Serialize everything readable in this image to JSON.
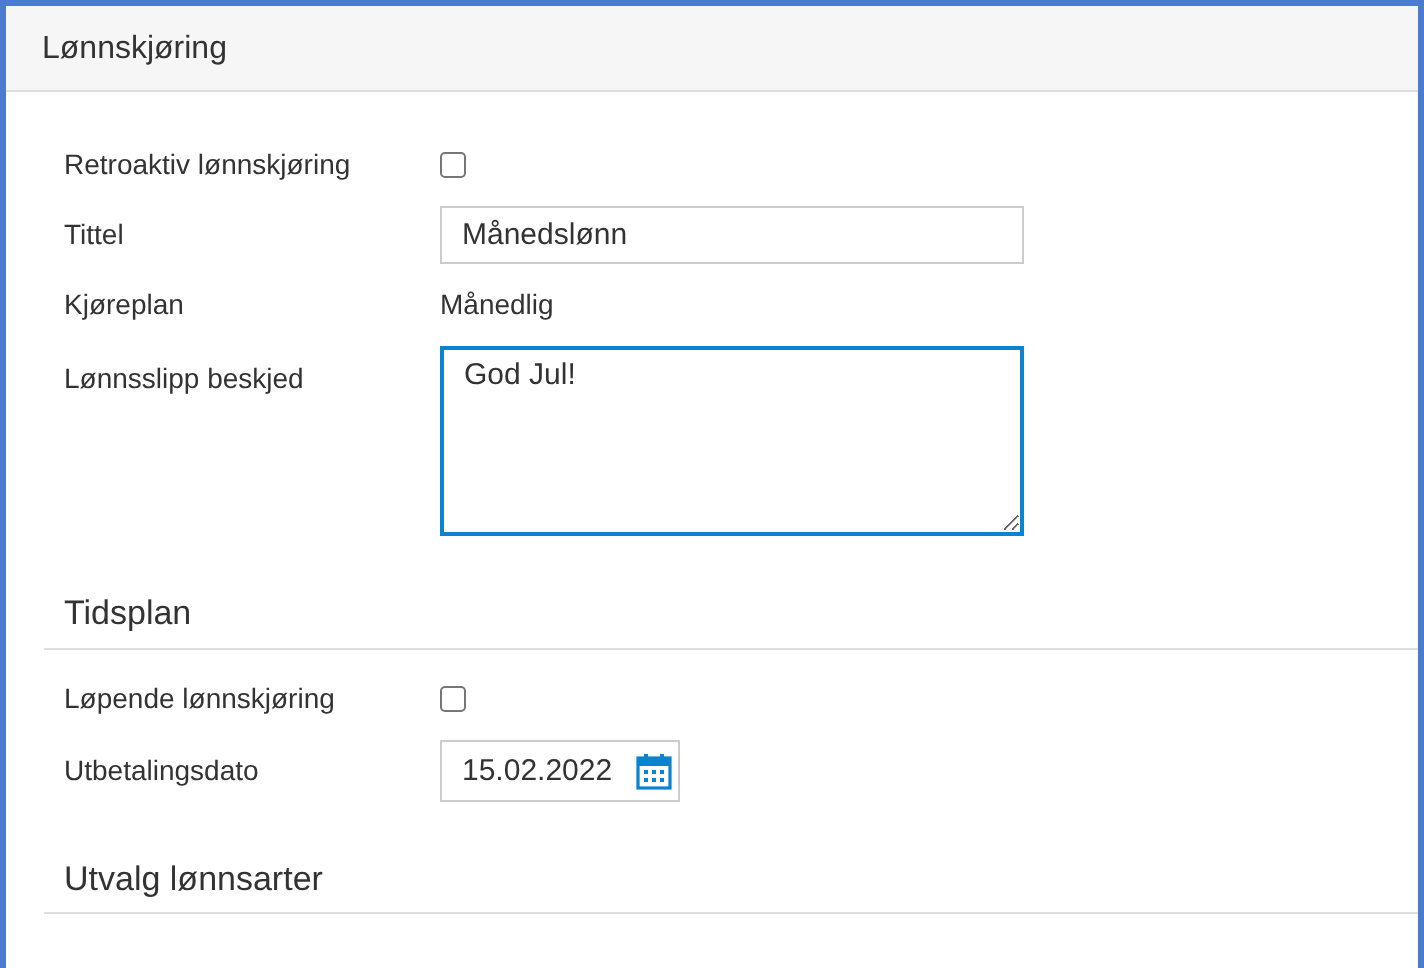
{
  "header": {
    "title": "Lønnskjøring"
  },
  "fields": [
    {
      "kind": "checkbox",
      "label": "Retroaktiv lønnskjøring",
      "checked": false
    },
    {
      "kind": "text",
      "label": "Tittel",
      "value": "Månedslønn"
    },
    {
      "kind": "static",
      "label": "Kjøreplan",
      "value": "Månedlig"
    },
    {
      "kind": "textarea",
      "label": "Lønnsslipp beskjed",
      "value": "God Jul!",
      "focused": true
    }
  ],
  "sections": [
    {
      "title": "Tidsplan",
      "fields": [
        {
          "kind": "checkbox",
          "label": "Løpende lønnskjøring",
          "checked": false
        },
        {
          "kind": "date",
          "label": "Utbetalingsdato",
          "value": "15.02.2022"
        }
      ]
    },
    {
      "title": "Utvalg lønnsarter"
    }
  ]
}
